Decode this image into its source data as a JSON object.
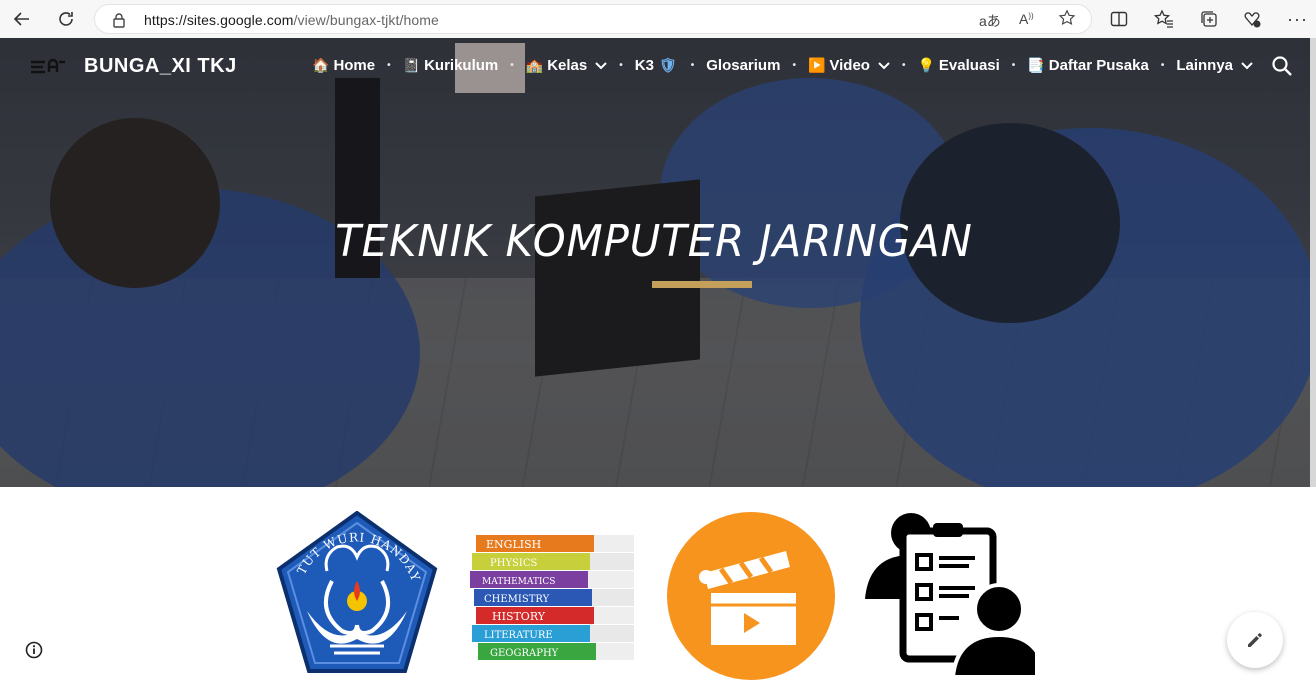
{
  "browser": {
    "url_host": "https://sites.google.com",
    "url_path": "/view/bungax-tjkt/home"
  },
  "site": {
    "title": "BUNGA_XI TKJ",
    "nav": [
      {
        "emoji": "🏠",
        "label": "Home"
      },
      {
        "emoji": "📓",
        "label": "Kurikulum"
      },
      {
        "emoji": "🏫",
        "label": "Kelas"
      },
      {
        "emoji": "",
        "label": "K3",
        "suffix": "🛡"
      },
      {
        "emoji": "",
        "label": "Glosarium"
      },
      {
        "emoji": "▶️",
        "label": "Video"
      },
      {
        "emoji": "💡",
        "label": "Evaluasi"
      },
      {
        "emoji": "📑",
        "label": "Daftar Pusaka"
      },
      {
        "emoji": "",
        "label": "Lainnya"
      }
    ]
  },
  "hero": {
    "title": "TEKNIK KOMPUTER JARINGAN"
  },
  "icons": {
    "logo_text": "TUT WURI HANDAYANI",
    "books": [
      "ENGLISH",
      "PHYSICS",
      "MATHEMATICS",
      "CHEMISTRY",
      "HISTORY",
      "LITERATURE",
      "GEOGRAPHY"
    ]
  },
  "colors": {
    "accent_bar": "#c4a05a",
    "video_circle": "#f7941d"
  }
}
